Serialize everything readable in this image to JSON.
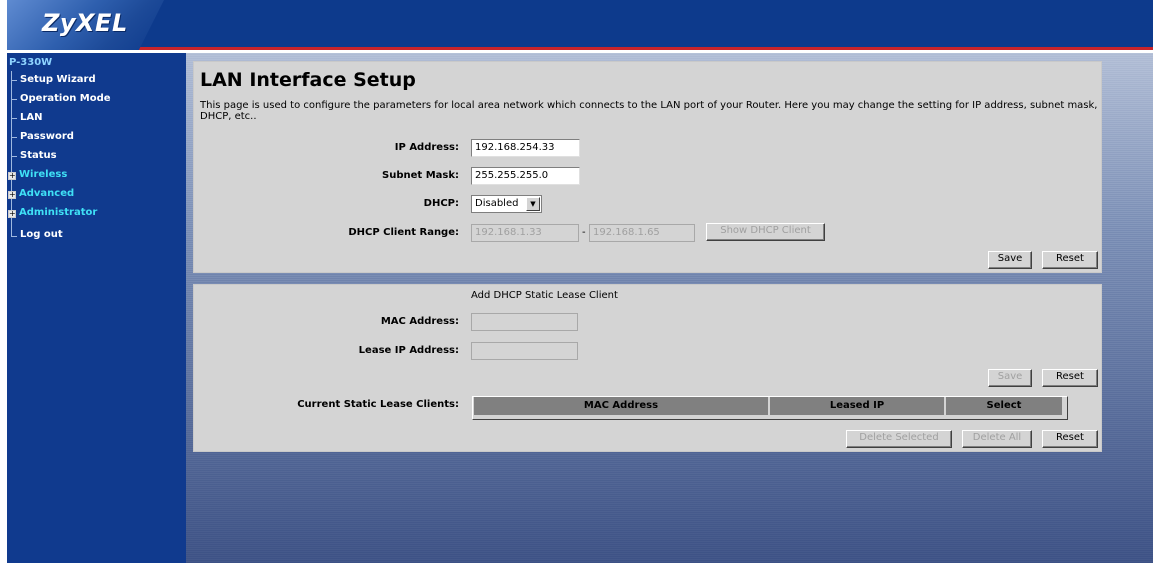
{
  "brand": {
    "logo": "ZyXEL"
  },
  "sidebar": {
    "model": "P-330W",
    "items": [
      {
        "label": "Setup Wizard",
        "expandable": false
      },
      {
        "label": "Operation Mode",
        "expandable": false
      },
      {
        "label": "LAN",
        "expandable": false
      },
      {
        "label": "Password",
        "expandable": false
      },
      {
        "label": "Status",
        "expandable": false
      },
      {
        "label": "Wireless",
        "expandable": true
      },
      {
        "label": "Advanced",
        "expandable": true
      },
      {
        "label": "Administrator",
        "expandable": true
      },
      {
        "label": "Log out",
        "expandable": false
      }
    ]
  },
  "page": {
    "title": "LAN Interface Setup",
    "description": "This page is used to configure the parameters for local area network which connects to the LAN port of your Router. Here you may change the setting for IP address, subnet mask, DHCP, etc.."
  },
  "lan": {
    "ip_label": "IP Address:",
    "ip_value": "192.168.254.33",
    "mask_label": "Subnet Mask:",
    "mask_value": "255.255.255.0",
    "dhcp_label": "DHCP:",
    "dhcp_value": "Disabled",
    "range_label": "DHCP Client Range:",
    "range_start": "192.168.1.33",
    "range_sep": "-",
    "range_end": "192.168.1.65",
    "show_client_button": "Show DHCP Client",
    "save_button": "Save",
    "reset_button": "Reset"
  },
  "static_lease": {
    "heading": "Add DHCP Static Lease Client",
    "mac_label": "MAC Address:",
    "mac_value": "",
    "ip_label": "Lease IP Address:",
    "ip_value": "",
    "save_button": "Save",
    "reset_button": "Reset",
    "current_label": "Current Static Lease Clients:",
    "columns": [
      "MAC Address",
      "Leased IP",
      "Select"
    ],
    "delete_selected_button": "Delete Selected",
    "delete_all_button": "Delete All",
    "reset2_button": "Reset"
  }
}
